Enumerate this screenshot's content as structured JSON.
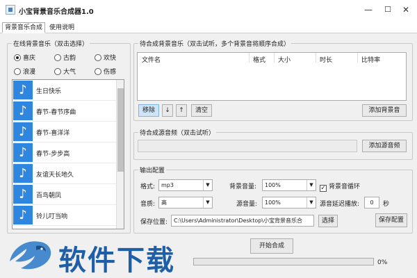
{
  "window": {
    "title": "小宝背景音乐合成器1.0",
    "min": "—",
    "max": "☐",
    "close": "✕"
  },
  "tabs": [
    {
      "label": "背景音乐合成",
      "active": true
    },
    {
      "label": "使用说明",
      "active": false
    }
  ],
  "online_music": {
    "legend": "在线背景音乐（双击选择）",
    "categories": [
      {
        "label": "喜庆",
        "selected": true
      },
      {
        "label": "古韵",
        "selected": false
      },
      {
        "label": "欢快",
        "selected": false
      },
      {
        "label": "浪漫",
        "selected": false
      },
      {
        "label": "大气",
        "selected": false
      },
      {
        "label": "伤感",
        "selected": false
      }
    ],
    "songs": [
      "生日快乐",
      "春节-春节序曲",
      "春节-喜洋洋",
      "春节-步步高",
      "友谊天长地久",
      "百鸟朝凤",
      "铃儿叮当响"
    ]
  },
  "bg_music": {
    "legend": "待合成背景音乐（双击试听，多个背景音将顺序合成）",
    "columns": [
      "文件名",
      "格式",
      "大小",
      "时长",
      "比特率"
    ],
    "buttons": {
      "remove": "移除",
      "up": "↓",
      "down": "↑",
      "clear": "清空",
      "add": "添加背景音"
    }
  },
  "source_audio": {
    "legend": "待合成源音频（双击试听）",
    "value": "",
    "add": "添加源音频"
  },
  "output": {
    "legend": "输出配置",
    "format_label": "格式:",
    "format_value": "mp3",
    "quality_label": "音质:",
    "quality_value": "高",
    "bg_volume_label": "背景音量:",
    "bg_volume_value": "100%",
    "src_volume_label": "源音量:",
    "src_volume_value": "100%",
    "loop_label": "背景音循环",
    "loop_checked": true,
    "delay_label": "源音延迟播放:",
    "delay_value": "0",
    "delay_unit": "秒",
    "save_label": "保存位置:",
    "save_path": "C:\\Users\\Administrator\\Desktop\\小宝背景音乐合",
    "choose": "选择",
    "save_config": "保存配置"
  },
  "start_button": "开始合成",
  "progress": {
    "percent_text": "0%",
    "value": 0
  },
  "watermark": {
    "text": "软件下载",
    "color": "#1e5fa8"
  },
  "colors": {
    "note_tile": "#2e86de",
    "accent": "#cfe4f7"
  },
  "icons": {
    "song": "music-note-icon",
    "app": "app-icon"
  }
}
